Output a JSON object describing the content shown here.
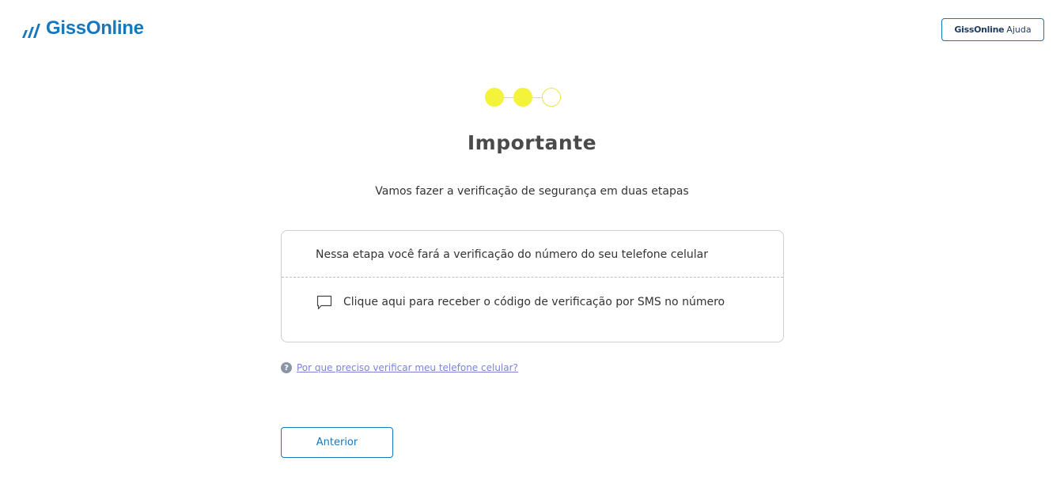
{
  "header": {
    "logo_text": "GissOnline",
    "logo_icon": "bar-chart-logo-icon",
    "help_button": {
      "brand": "GissOnline",
      "label": "Ajuda"
    }
  },
  "stepper": {
    "total_steps": 3,
    "completed_steps": 2,
    "colors": {
      "done": "#f3f33a",
      "todo_border": "#e6e64a"
    }
  },
  "main": {
    "title": "Importante",
    "subtitle": "Vamos fazer a verificação de segurança em duas etapas"
  },
  "card": {
    "info_text": "Nessa etapa você fará a verificação do número do seu telefone celular",
    "sms_option": {
      "icon": "chat-bubble-icon",
      "text": "Clique aqui para receber o código de verificação por SMS no número"
    }
  },
  "help_link": {
    "icon": "question-circle-icon",
    "text": "Por que preciso verificar meu telefone celular?"
  },
  "actions": {
    "back_label": "Anterior"
  },
  "colors": {
    "brand_blue": "#1478be",
    "link": "#7b84d8",
    "step_yellow": "#f3f33a"
  }
}
